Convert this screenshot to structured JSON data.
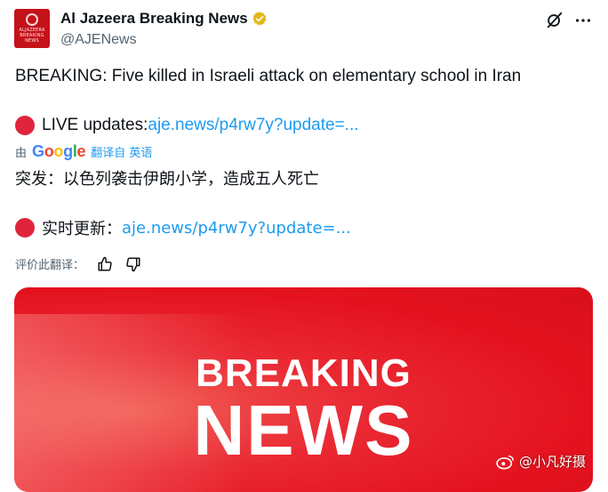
{
  "account": {
    "display_name": "Al Jazeera Breaking News",
    "handle": "@AJENews",
    "avatar_text": "ALJAZEERA BREAKING NEWS",
    "verified_color": "#e2b719"
  },
  "tweet": {
    "headline": "BREAKING: Five killed in Israeli attack on elementary school in Iran",
    "live_label": "LIVE updates: ",
    "live_link": "aje.news/p4rw7y?update=...",
    "translated_by_prefix": "由",
    "translated_by_brand": "Google",
    "translated_from": "翻译自 英语",
    "translated_headline": "突发：以色列袭击伊朗小学，造成五人死亡",
    "translated_live_label": "实时更新： ",
    "translated_live_link": "aje.news/p4rw7y?update=...",
    "rate_translation": "评价此翻译："
  },
  "media": {
    "line1": "BREAKING",
    "line2": "NEWS",
    "background_color": "#e4121f"
  },
  "watermark": {
    "text": "@小凡好摄"
  },
  "colors": {
    "link": "#1d9bf0",
    "red_dot": "#e0243b",
    "secondary_text": "#536471"
  },
  "icons": [
    "verified-badge-icon",
    "grok-icon",
    "more-icon",
    "thumbs-up-icon",
    "thumbs-down-icon",
    "weibo-icon"
  ]
}
